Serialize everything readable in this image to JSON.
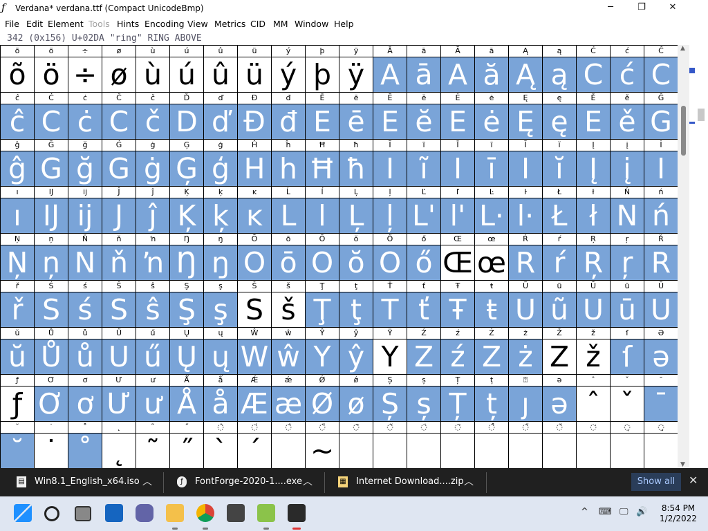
{
  "window": {
    "title": "Verdana* verdana.ttf (Compact UnicodeBmp)",
    "minimize": "─",
    "maximize": "❐",
    "close": "✕"
  },
  "menu": [
    {
      "label": "File",
      "enabled": true
    },
    {
      "label": "Edit",
      "enabled": true
    },
    {
      "label": "Element",
      "enabled": true
    },
    {
      "label": "Tools",
      "enabled": false
    },
    {
      "label": "Hints",
      "enabled": true
    },
    {
      "label": "Encoding",
      "enabled": true
    },
    {
      "label": "View",
      "enabled": true
    },
    {
      "label": "Metrics",
      "enabled": true
    },
    {
      "label": "CID",
      "enabled": true
    },
    {
      "label": "MM",
      "enabled": true
    },
    {
      "label": "Window",
      "enabled": true
    },
    {
      "label": "Help",
      "enabled": true
    }
  ],
  "char_info": "342 (0x156) U+02DA \"ring\" RING ABOVE",
  "colors": {
    "selected": "#7aa4d8",
    "taskbar": "#dfe6f2",
    "downloads_bar": "#202020"
  },
  "grid": {
    "rows": [
      {
        "labels": [
          "õ",
          "ö",
          "÷",
          "ø",
          "ù",
          "ú",
          "û",
          "ü",
          "ý",
          "þ",
          "ÿ",
          "Ā",
          "ā",
          "Ă",
          "ă",
          "Ą",
          "ą",
          "Ć",
          "ć",
          "Ĉ"
        ],
        "glyphs": [
          "õ",
          "ö",
          "÷",
          "ø",
          "ù",
          "ú",
          "û",
          "ü",
          "ý",
          "þ",
          "ÿ",
          "A",
          "ā",
          "A",
          "ă",
          "Ą",
          "ą",
          "C",
          "ć",
          "C"
        ],
        "selected": [
          0,
          0,
          0,
          0,
          0,
          0,
          0,
          0,
          0,
          0,
          0,
          1,
          1,
          1,
          1,
          1,
          1,
          1,
          1,
          1
        ]
      },
      {
        "labels": [
          "ĉ",
          "Ċ",
          "ċ",
          "Č",
          "č",
          "Ď",
          "ď",
          "Đ",
          "đ",
          "Ē",
          "ē",
          "Ĕ",
          "ĕ",
          "Ė",
          "ė",
          "Ę",
          "ę",
          "Ě",
          "ě",
          "Ĝ"
        ],
        "glyphs": [
          "ĉ",
          "C",
          "ċ",
          "C",
          "č",
          "D",
          "ď",
          "Đ",
          "đ",
          "E",
          "ē",
          "E",
          "ĕ",
          "E",
          "ė",
          "Ę",
          "ę",
          "E",
          "ě",
          "G"
        ],
        "selected": [
          1,
          1,
          1,
          1,
          1,
          1,
          1,
          1,
          1,
          1,
          1,
          1,
          1,
          1,
          1,
          1,
          1,
          1,
          1,
          1
        ]
      },
      {
        "labels": [
          "ĝ",
          "Ğ",
          "ğ",
          "Ġ",
          "ġ",
          "Ģ",
          "ģ",
          "Ĥ",
          "ĥ",
          "Ħ",
          "ħ",
          "Ĩ",
          "ĩ",
          "Ī",
          "ī",
          "Ĭ",
          "ĭ",
          "Į",
          "į",
          "İ"
        ],
        "glyphs": [
          "ĝ",
          "G",
          "ğ",
          "G",
          "ġ",
          "Ģ",
          "ģ",
          "H",
          "h",
          "Ħ",
          "ħ",
          "I",
          "ĩ",
          "I",
          "ī",
          "I",
          "ĭ",
          "Į",
          "į",
          "I"
        ],
        "selected": [
          1,
          1,
          1,
          1,
          1,
          1,
          1,
          1,
          1,
          1,
          1,
          1,
          1,
          1,
          1,
          1,
          1,
          1,
          1,
          1
        ]
      },
      {
        "labels": [
          "ı",
          "Ĳ",
          "ĳ",
          "Ĵ",
          "ĵ",
          "Ķ",
          "ķ",
          "ĸ",
          "Ĺ",
          "ĺ",
          "Ļ",
          "ļ",
          "Ľ",
          "ľ",
          "Ŀ",
          "ŀ",
          "Ł",
          "ł",
          "Ń",
          "ń"
        ],
        "glyphs": [
          "ı",
          "IJ",
          "ij",
          "J",
          "ĵ",
          "Ķ",
          "ķ",
          "ĸ",
          "L",
          "l",
          "Ļ",
          "ļ",
          "L'",
          "l'",
          "L·",
          "l·",
          "Ł",
          "ł",
          "N",
          "ń"
        ],
        "selected": [
          1,
          1,
          1,
          1,
          1,
          1,
          1,
          1,
          1,
          1,
          1,
          1,
          1,
          1,
          1,
          1,
          1,
          1,
          1,
          1
        ]
      },
      {
        "labels": [
          "Ņ",
          "ņ",
          "Ň",
          "ň",
          "ŉ",
          "Ŋ",
          "ŋ",
          "Ō",
          "ō",
          "Ŏ",
          "ŏ",
          "Ő",
          "ő",
          "Œ",
          "œ",
          "Ŕ",
          "ŕ",
          "Ŗ",
          "ŗ",
          "Ř"
        ],
        "glyphs": [
          "Ņ",
          "ņ",
          "N",
          "ň",
          "ŉ",
          "Ŋ",
          "ŋ",
          "O",
          "ō",
          "O",
          "ŏ",
          "O",
          "ő",
          "Œ",
          "œ",
          "R",
          "ŕ",
          "Ŗ",
          "ŗ",
          "R"
        ],
        "selected": [
          1,
          1,
          1,
          1,
          1,
          1,
          1,
          1,
          1,
          1,
          1,
          1,
          1,
          0,
          0,
          1,
          1,
          1,
          1,
          1
        ]
      },
      {
        "labels": [
          "ř",
          "Ś",
          "ś",
          "Ŝ",
          "ŝ",
          "Ş",
          "ş",
          "Š",
          "š",
          "Ţ",
          "ţ",
          "Ť",
          "ť",
          "Ŧ",
          "ŧ",
          "Ũ",
          "ũ",
          "Ū",
          "ū",
          "Ŭ"
        ],
        "glyphs": [
          "ř",
          "S",
          "ś",
          "S",
          "ŝ",
          "Ş",
          "ş",
          "S",
          "š",
          "Ţ",
          "ţ",
          "T",
          "ť",
          "Ŧ",
          "ŧ",
          "U",
          "ũ",
          "U",
          "ū",
          "U"
        ],
        "selected": [
          1,
          1,
          1,
          1,
          1,
          1,
          1,
          0,
          0,
          1,
          1,
          1,
          1,
          1,
          1,
          1,
          1,
          1,
          1,
          1
        ]
      },
      {
        "labels": [
          "ŭ",
          "Ů",
          "ů",
          "Ű",
          "ű",
          "Ų",
          "ų",
          "Ŵ",
          "ŵ",
          "Ŷ",
          "ŷ",
          "Ÿ",
          "Ź",
          "ź",
          "Ż",
          "ż",
          "Ž",
          "ž",
          "ſ",
          "Ə"
        ],
        "glyphs": [
          "ŭ",
          "Ů",
          "ů",
          "U",
          "ű",
          "Ų",
          "ų",
          "W",
          "ŵ",
          "Y",
          "ŷ",
          "Y",
          "Z",
          "ź",
          "Z",
          "ż",
          "Z",
          "ž",
          "ſ",
          "ə"
        ],
        "selected": [
          1,
          1,
          1,
          1,
          1,
          1,
          1,
          1,
          1,
          1,
          1,
          0,
          1,
          1,
          1,
          1,
          0,
          0,
          1,
          1
        ]
      },
      {
        "labels": [
          "ƒ",
          "Ơ",
          "ơ",
          "Ư",
          "ư",
          "Ǻ",
          "ǻ",
          "Ǽ",
          "ǽ",
          "Ǿ",
          "ǿ",
          "Ș",
          "ș",
          "Ț",
          "ț",
          "⍰",
          "ə",
          "ˆ",
          "ˇ",
          "ˉ"
        ],
        "glyphs": [
          "ƒ",
          "Ơ",
          "ơ",
          "Ư",
          "ư",
          "Å",
          "å",
          "Æ",
          "æ",
          "Ø",
          "ø",
          "Ș",
          "ș",
          "Ț",
          "ț",
          "ȷ",
          "ə",
          "ˆ",
          "ˇ",
          "ˉ"
        ],
        "selected": [
          0,
          1,
          1,
          1,
          1,
          1,
          1,
          1,
          1,
          1,
          1,
          1,
          1,
          1,
          1,
          1,
          1,
          0,
          0,
          1
        ]
      },
      {
        "labels": [
          "˘",
          "˙",
          "˚",
          "˛",
          "˜",
          "˝",
          "◌̀",
          "◌́",
          "◌̂",
          "◌̃",
          "◌̄",
          "◌̆",
          "◌̇",
          "◌̈",
          "◌̊",
          "◌̋",
          "◌̌",
          "◌̒",
          "◌̦",
          "◌̧"
        ],
        "glyphs": [
          "˘",
          "˙",
          "˚",
          "˛",
          "˜",
          "˝",
          "`",
          "´",
          "",
          "~",
          "",
          "",
          "",
          "",
          "",
          "",
          "",
          "",
          "",
          "",
          ""
        ],
        "selected": [
          1,
          0,
          1,
          0,
          0,
          0,
          0,
          0,
          0,
          0,
          0,
          0,
          0,
          0,
          0,
          0,
          0,
          0,
          0,
          0
        ]
      }
    ]
  },
  "downloads": [
    {
      "name": "Win8.1_English_x64.iso",
      "icon": "iso-file-icon"
    },
    {
      "name": "FontForge-2020-1....exe",
      "icon": "exe-file-icon"
    },
    {
      "name": "Internet Download....zip",
      "icon": "zip-file-icon"
    }
  ],
  "downloads_show_all": "Show all",
  "downloads_close": "✕",
  "taskbar": {
    "icons": [
      "windows-start-icon",
      "search-icon",
      "task-view-icon",
      "widgets-icon",
      "teams-chat-icon",
      "file-explorer-icon",
      "chrome-icon",
      "microsoft-store-icon",
      "archive-manager-icon",
      "fontforge-icon"
    ],
    "time": "8:54 PM",
    "date": "1/2/2022",
    "tray": [
      "^",
      "⌨",
      "🖵",
      "🔊"
    ]
  }
}
